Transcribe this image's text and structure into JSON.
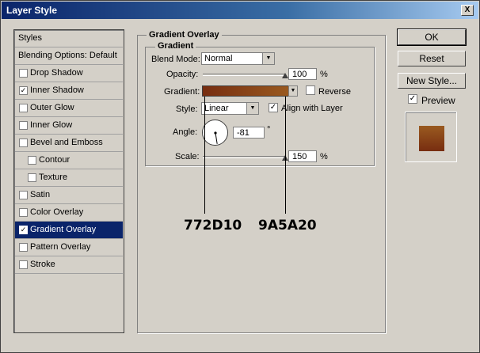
{
  "window": {
    "title": "Layer Style",
    "close_glyph": "X"
  },
  "sidebar": {
    "items": [
      {
        "label": "Styles",
        "type": "header",
        "checked": false
      },
      {
        "label": "Blending Options: Default",
        "type": "header",
        "checked": false
      },
      {
        "label": "Drop Shadow",
        "type": "item",
        "checked": false
      },
      {
        "label": "Inner Shadow",
        "type": "item",
        "checked": true
      },
      {
        "label": "Outer Glow",
        "type": "item",
        "checked": false
      },
      {
        "label": "Inner Glow",
        "type": "item",
        "checked": false
      },
      {
        "label": "Bevel and Emboss",
        "type": "item",
        "checked": false
      },
      {
        "label": "Contour",
        "type": "sub",
        "checked": false
      },
      {
        "label": "Texture",
        "type": "sub",
        "checked": false
      },
      {
        "label": "Satin",
        "type": "item",
        "checked": false
      },
      {
        "label": "Color Overlay",
        "type": "item",
        "checked": false
      },
      {
        "label": "Gradient Overlay",
        "type": "item",
        "checked": true,
        "selected": true
      },
      {
        "label": "Pattern Overlay",
        "type": "item",
        "checked": false
      },
      {
        "label": "Stroke",
        "type": "item",
        "checked": false
      }
    ]
  },
  "gradient_overlay": {
    "group_title": "Gradient Overlay",
    "subgroup_title": "Gradient",
    "blend_mode_label": "Blend Mode:",
    "blend_mode_value": "Normal",
    "opacity_label": "Opacity:",
    "opacity_value": "100",
    "opacity_unit": "%",
    "opacity_fraction": 1.0,
    "gradient_label": "Gradient:",
    "gradient_colors": [
      "#772d10",
      "#9a5a20"
    ],
    "reverse_label": "Reverse",
    "reverse_checked": false,
    "style_label": "Style:",
    "style_value": "Linear",
    "align_label": "Align with Layer",
    "align_checked": true,
    "angle_label": "Angle:",
    "angle_value": "-81",
    "angle_unit": "°",
    "scale_label": "Scale:",
    "scale_value": "150",
    "scale_unit": "%",
    "scale_fraction": 1.0
  },
  "buttons": {
    "ok": "OK",
    "reset": "Reset",
    "new_style": "New Style...",
    "preview_label": "Preview",
    "preview_checked": true
  },
  "callouts": {
    "left": "772D10",
    "right": "9A5A20"
  },
  "check_glyph": "✓",
  "dropdown_glyph": "▼"
}
